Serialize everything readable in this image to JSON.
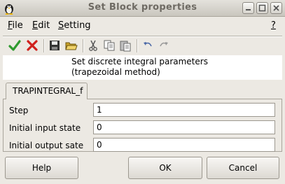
{
  "window": {
    "title": "Set Block properties",
    "icon": "penguin-icon",
    "controls": [
      "minimize-icon",
      "maximize-icon",
      "close-icon"
    ]
  },
  "menu": {
    "file": {
      "mnemonic": "F",
      "rest": "ile"
    },
    "edit": {
      "mnemonic": "E",
      "rest": "dit"
    },
    "setting": {
      "mnemonic": "S",
      "rest": "etting"
    },
    "help": {
      "mnemonic": "?",
      "rest": ""
    }
  },
  "toolbar": {
    "icons": [
      "ok-check-icon",
      "cancel-x-icon",
      "save-icon",
      "open-folder-icon",
      "cut-icon",
      "copy-icon",
      "paste-icon",
      "undo-icon",
      "redo-icon"
    ]
  },
  "description": {
    "line1": "Set discrete integral parameters",
    "line2": "(trapezoidal method)"
  },
  "tab": {
    "label": "TRAPINTEGRAL_f"
  },
  "params": [
    {
      "label": "Step",
      "value": "1"
    },
    {
      "label": "Initial input state",
      "value": "0"
    },
    {
      "label": "Initial output sate",
      "value": "0"
    }
  ],
  "buttons": {
    "help": "Help",
    "ok": "OK",
    "cancel": "Cancel"
  },
  "colors": {
    "check_green": "#2e9a2e",
    "cancel_red": "#d0201c",
    "background": "#ece9e3"
  }
}
